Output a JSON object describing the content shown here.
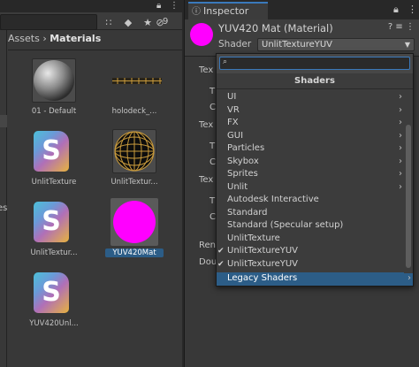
{
  "project": {
    "toolbar": {
      "hidden_count": "9"
    },
    "breadcrumb": {
      "root": "Assets",
      "separator": "›",
      "current": "Materials"
    },
    "tree_fragment": "es",
    "assets": [
      {
        "label": "01 - Default",
        "kind": "sphere-gray"
      },
      {
        "label": "holodeck_...",
        "kind": "texture-strip"
      },
      {
        "label": "UnlitTexture",
        "kind": "shader"
      },
      {
        "label": "UnlitTextur...",
        "kind": "sphere-wire"
      },
      {
        "label": "UnlitTextur...",
        "kind": "shader"
      },
      {
        "label": "YUV420Mat",
        "kind": "sphere-magenta",
        "selected": true
      },
      {
        "label": "YUV420Unl...",
        "kind": "shader"
      }
    ]
  },
  "inspector": {
    "tab_label": "Inspector",
    "material_title": "YUV420 Mat (Material)",
    "shader_label": "Shader",
    "shader_value": "UnlitTextureYUV",
    "preview_color": "#ff00ff",
    "property_fragments": [
      "Tex",
      "T",
      "C",
      "Tex",
      "T",
      "C",
      "Tex",
      "T",
      "C",
      "Ren",
      "Dou"
    ]
  },
  "shader_popup": {
    "search_value": "",
    "title": "Shaders",
    "items": [
      {
        "label": "UI",
        "submenu": true,
        "checked": false
      },
      {
        "label": "VR",
        "submenu": true,
        "checked": false
      },
      {
        "label": "FX",
        "submenu": true,
        "checked": false
      },
      {
        "label": "GUI",
        "submenu": true,
        "checked": false
      },
      {
        "label": "Particles",
        "submenu": true,
        "checked": false
      },
      {
        "label": "Skybox",
        "submenu": true,
        "checked": false
      },
      {
        "label": "Sprites",
        "submenu": true,
        "checked": false
      },
      {
        "label": "Unlit",
        "submenu": true,
        "checked": false
      },
      {
        "label": "Autodesk Interactive",
        "submenu": false,
        "checked": false
      },
      {
        "label": "Standard",
        "submenu": false,
        "checked": false
      },
      {
        "label": "Standard (Specular setup)",
        "submenu": false,
        "checked": false
      },
      {
        "label": "UnlitTexture",
        "submenu": false,
        "checked": false
      },
      {
        "label": "UnlitTextureYUV",
        "submenu": false,
        "checked": true
      },
      {
        "label": "UnlitTextureYUV",
        "submenu": false,
        "checked": true
      },
      {
        "label": "Legacy Shaders",
        "submenu": true,
        "checked": false,
        "highlighted": true
      }
    ]
  },
  "colors": {
    "accent": "#2c5d87",
    "tab_accent": "#3a79bb",
    "magenta": "#ff00ff"
  },
  "icons": [
    "lock-icon",
    "menu-icon",
    "scene-filter-icon",
    "label-icon",
    "favorite-icon",
    "hidden-eye-icon",
    "help-icon",
    "preset-icon",
    "more-icon",
    "chevron-right-icon",
    "checkmark-icon",
    "search-icon",
    "dropdown-arrow-icon"
  ]
}
